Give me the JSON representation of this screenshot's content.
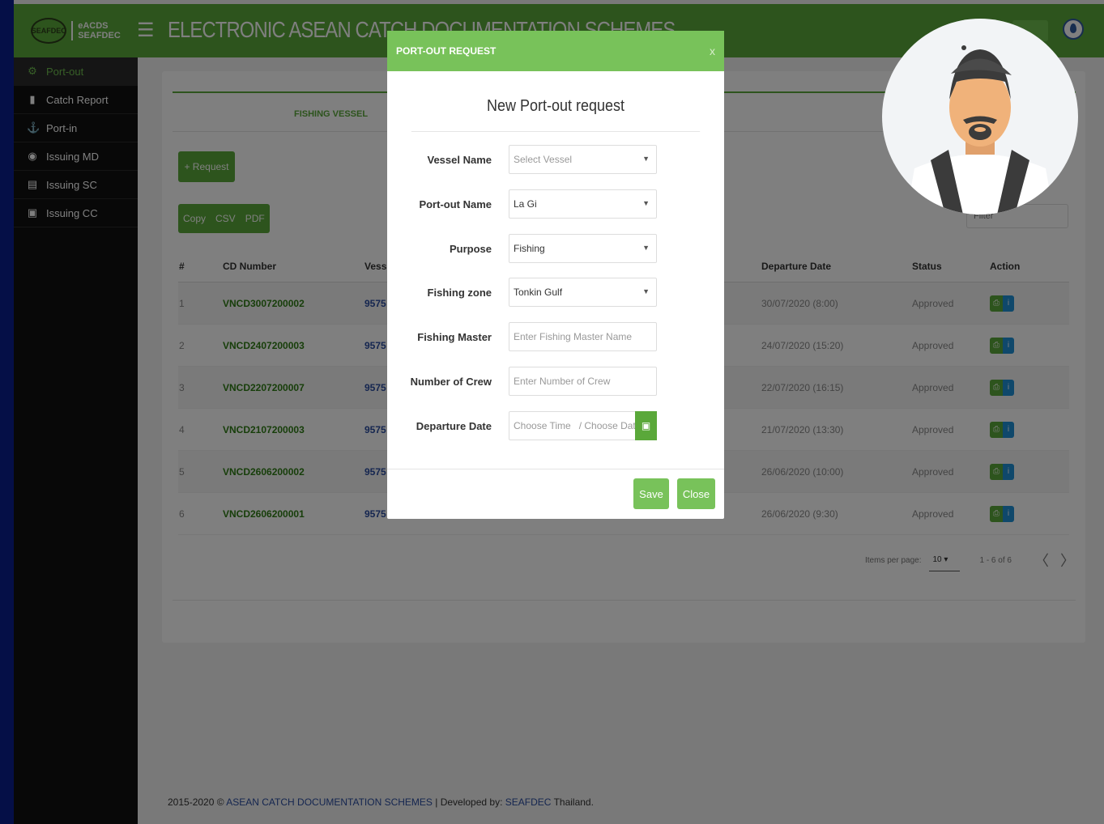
{
  "header": {
    "logo_line1": "eACDS",
    "logo_line2": "SEAFDEC",
    "logo_mark": "SEAFDEC",
    "title": "ELECTRONIC ASEAN CATCH DOCUMENTATION SCHEMES",
    "menu_icon": "hamburger-icon",
    "colors": {
      "brand": "#5aa83a"
    }
  },
  "sidebar": {
    "items": [
      {
        "label": "Port-out",
        "icon": "gear-icon",
        "active": true
      },
      {
        "label": "Catch Report",
        "icon": "document-icon"
      },
      {
        "label": "Port-in",
        "icon": "anchor-icon"
      },
      {
        "label": "Issuing MD",
        "icon": "badge-icon"
      },
      {
        "label": "Issuing SC",
        "icon": "factory-icon"
      },
      {
        "label": "Issuing CC",
        "icon": "cc-icon"
      }
    ]
  },
  "main": {
    "tab_label": "FISHING VESSEL",
    "request_button": "+ Request",
    "export": [
      "Copy",
      "CSV",
      "PDF"
    ],
    "filter_placeholder": "Filter",
    "table": {
      "headers": [
        "#",
        "CD Number",
        "Vess",
        "Departure Date",
        "Status",
        "Action"
      ],
      "rows": [
        {
          "n": "1",
          "cd": "VNCD3007200002",
          "vessel": "9575",
          "date": "30/07/2020 (8:00)",
          "status": "Approved"
        },
        {
          "n": "2",
          "cd": "VNCD2407200003",
          "vessel": "9575",
          "date": "24/07/2020 (15:20)",
          "status": "Approved"
        },
        {
          "n": "3",
          "cd": "VNCD2207200007",
          "vessel": "9575",
          "date": "22/07/2020 (16:15)",
          "status": "Approved"
        },
        {
          "n": "4",
          "cd": "VNCD2107200003",
          "vessel": "9575",
          "date": "21/07/2020 (13:30)",
          "status": "Approved"
        },
        {
          "n": "5",
          "cd": "VNCD2606200002",
          "vessel": "9575",
          "date": "26/06/2020 (10:00)",
          "status": "Approved"
        },
        {
          "n": "6",
          "cd": "VNCD2606200001",
          "vessel": "9575",
          "date": "26/06/2020 (9:30)",
          "status": "Approved"
        }
      ]
    },
    "pager": {
      "items_label": "Items per page:",
      "page_size": "10",
      "range": "1 - 6 of 6",
      "prev": "〈",
      "next": "〉"
    }
  },
  "footer": {
    "prefix": "2015-2020 © ",
    "link1": "ASEAN CATCH DOCUMENTATION SCHEMES",
    "mid": " | Developed by: ",
    "link2": "SEAFDEC",
    "suffix": " Thailand."
  },
  "modal": {
    "bar_title": "PORT-OUT REQUEST",
    "close_x": "x",
    "heading": "New Port-out request",
    "fields": {
      "vessel_name": {
        "label": "Vessel Name",
        "value": "Select Vessel"
      },
      "port_out_name": {
        "label": "Port-out Name",
        "value": "La Gi"
      },
      "purpose": {
        "label": "Purpose",
        "value": "Fishing"
      },
      "fishing_zone": {
        "label": "Fishing zone",
        "value": "Tonkin Gulf"
      },
      "fishing_master": {
        "label": "Fishing Master",
        "placeholder": "Enter Fishing Master Name"
      },
      "number_of_crew": {
        "label": "Number of Crew",
        "placeholder": "Enter Number of Crew"
      },
      "departure_date": {
        "label": "Departure Date",
        "time_placeholder": "Choose Time",
        "date_placeholder": "/ Choose Date"
      }
    },
    "save": "Save",
    "close": "Close"
  }
}
